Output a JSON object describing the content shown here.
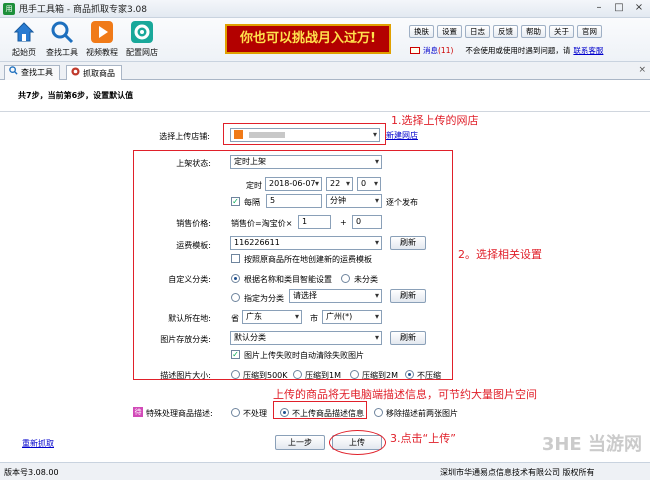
{
  "app": {
    "icon_char": "用",
    "title": "甩手工具箱 - 商品抓取专家3.08"
  },
  "window": {
    "minimize": "–",
    "maximize": "□",
    "close": "×"
  },
  "toolbar": {
    "items": [
      {
        "label": "起始页",
        "icon": "home-icon"
      },
      {
        "label": "查找工具",
        "icon": "search-icon"
      },
      {
        "label": "视频教程",
        "icon": "play-icon"
      },
      {
        "label": "配置网店",
        "icon": "settings-icon"
      }
    ],
    "banner": "你也可以挑战月入过万!",
    "buttons": [
      "换肤",
      "设置",
      "日志",
      "反馈",
      "帮助",
      "关于",
      "官网"
    ],
    "message_label": "消息",
    "message_count": "(11)",
    "help_text": "不会使用或使用时遇到问题，请",
    "help_link": "联系客服"
  },
  "tabs": [
    {
      "label": "查找工具",
      "icon": "search-icon"
    },
    {
      "label": "抓取商品",
      "icon": "grab-icon",
      "active": true
    }
  ],
  "tab_close": "×",
  "form": {
    "step": "共7步，当前第6步，设置默认值",
    "store_label": "选择上传店铺:",
    "store_value": "",
    "new_store_link": "新建网店",
    "listing_label": "上架状态:",
    "listing_value": "定时上架",
    "timed_label": "定时",
    "timed_date": "2018-06-07",
    "timed_hour": "22",
    "timed_minute": "0",
    "every_label": "每隔",
    "every_value": "5",
    "every_unit": "分钟",
    "every_suffix": "逐个发布",
    "price_label": "销售价格:",
    "price_formula": "销售价=淘宝价×",
    "price_multiplier": "1",
    "price_plus": "+",
    "price_addend": "0",
    "freight_label": "运费模板:",
    "freight_value": "116226611",
    "refresh": "刷新",
    "freight_check": "按照原商品所在地创建新的运费模板",
    "category_label": "自定义分类:",
    "category_opt1": "根据名称和类目智能设置",
    "category_opt2": "未分类",
    "category_opt3": "指定为分类",
    "category_select": "请选择",
    "location_label": "默认所在地:",
    "province_label": "省",
    "province_value": "广东",
    "city_label": "市",
    "city_value": "广州(*)",
    "image_cat_label": "图片存放分类:",
    "image_cat_value": "默认分类",
    "image_fail_check": "图片上传失败时自动清除失败图片",
    "compress_label": "描述图片大小:",
    "compress_opts": [
      "压缩到500K",
      "压缩到1M",
      "压缩到2M",
      "不压缩"
    ],
    "special_label": "特殊处理商品描述:",
    "special_icon_char": "待",
    "special_opts": [
      "不处理",
      "不上传商品描述信息",
      "移除描述前两张图片"
    ],
    "reselect_link": "重新抓取",
    "prev_button": "上一步",
    "upload_button": "上传"
  },
  "annotations": {
    "a1": "1.选择上传的网店",
    "a2": "2。选择相关设置",
    "a3": "上传的商品将无电脑端描述信息，可节约大量图片空间",
    "a4": "3.点击“上传”"
  },
  "status": {
    "version": "版本号3.08.00",
    "copyright": "深圳市华通易点信息技术有限公司 版权所有"
  },
  "watermark": "3HE 当游网",
  "colors": {
    "annotation_red": "#e0202a",
    "banner_bg": "#b30000",
    "banner_text": "#ffe24d",
    "link_blue": "#0000cc"
  }
}
